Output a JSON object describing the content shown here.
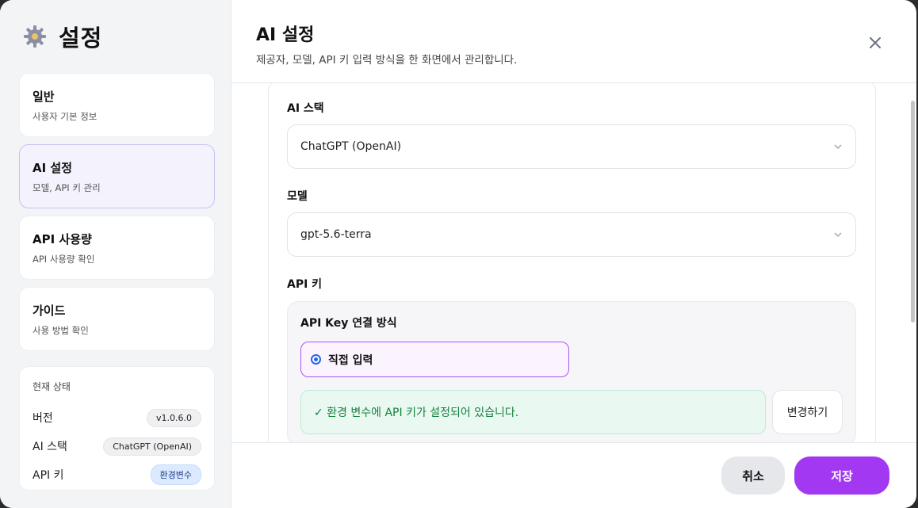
{
  "sidebar": {
    "title": "설정",
    "nav": [
      {
        "title": "일반",
        "subtitle": "사용자 기본 정보"
      },
      {
        "title": "AI 설정",
        "subtitle": "모델, API 키 관리"
      },
      {
        "title": "API 사용량",
        "subtitle": "API 사용량 확인"
      },
      {
        "title": "가이드",
        "subtitle": "사용 방법 확인"
      }
    ],
    "status": {
      "title": "현재 상태",
      "version_label": "버전",
      "version_value": "v1.0.6.0",
      "stack_label": "AI 스택",
      "stack_value": "ChatGPT (OpenAI)",
      "key_label": "API 키",
      "key_value": "환경변수"
    }
  },
  "header": {
    "title": "AI 설정",
    "subtitle": "제공자, 모델, API 키 입력 방식을 한 화면에서 관리합니다."
  },
  "form": {
    "stack_label": "AI 스택",
    "stack_value": "ChatGPT (OpenAI)",
    "model_label": "모델",
    "model_value": "gpt-5.6-terra",
    "key_label": "API 키",
    "key_method_label": "API Key 연결 방식",
    "radio_direct": "직접 입력",
    "env_message": "✓ 환경 변수에 API 키가 설정되어 있습니다.",
    "change_button": "변경하기"
  },
  "footer": {
    "cancel": "취소",
    "save": "저장"
  },
  "colors": {
    "accent": "#a238f1",
    "active_nav": "#f3f2fd",
    "env_ok": "#15803d"
  }
}
